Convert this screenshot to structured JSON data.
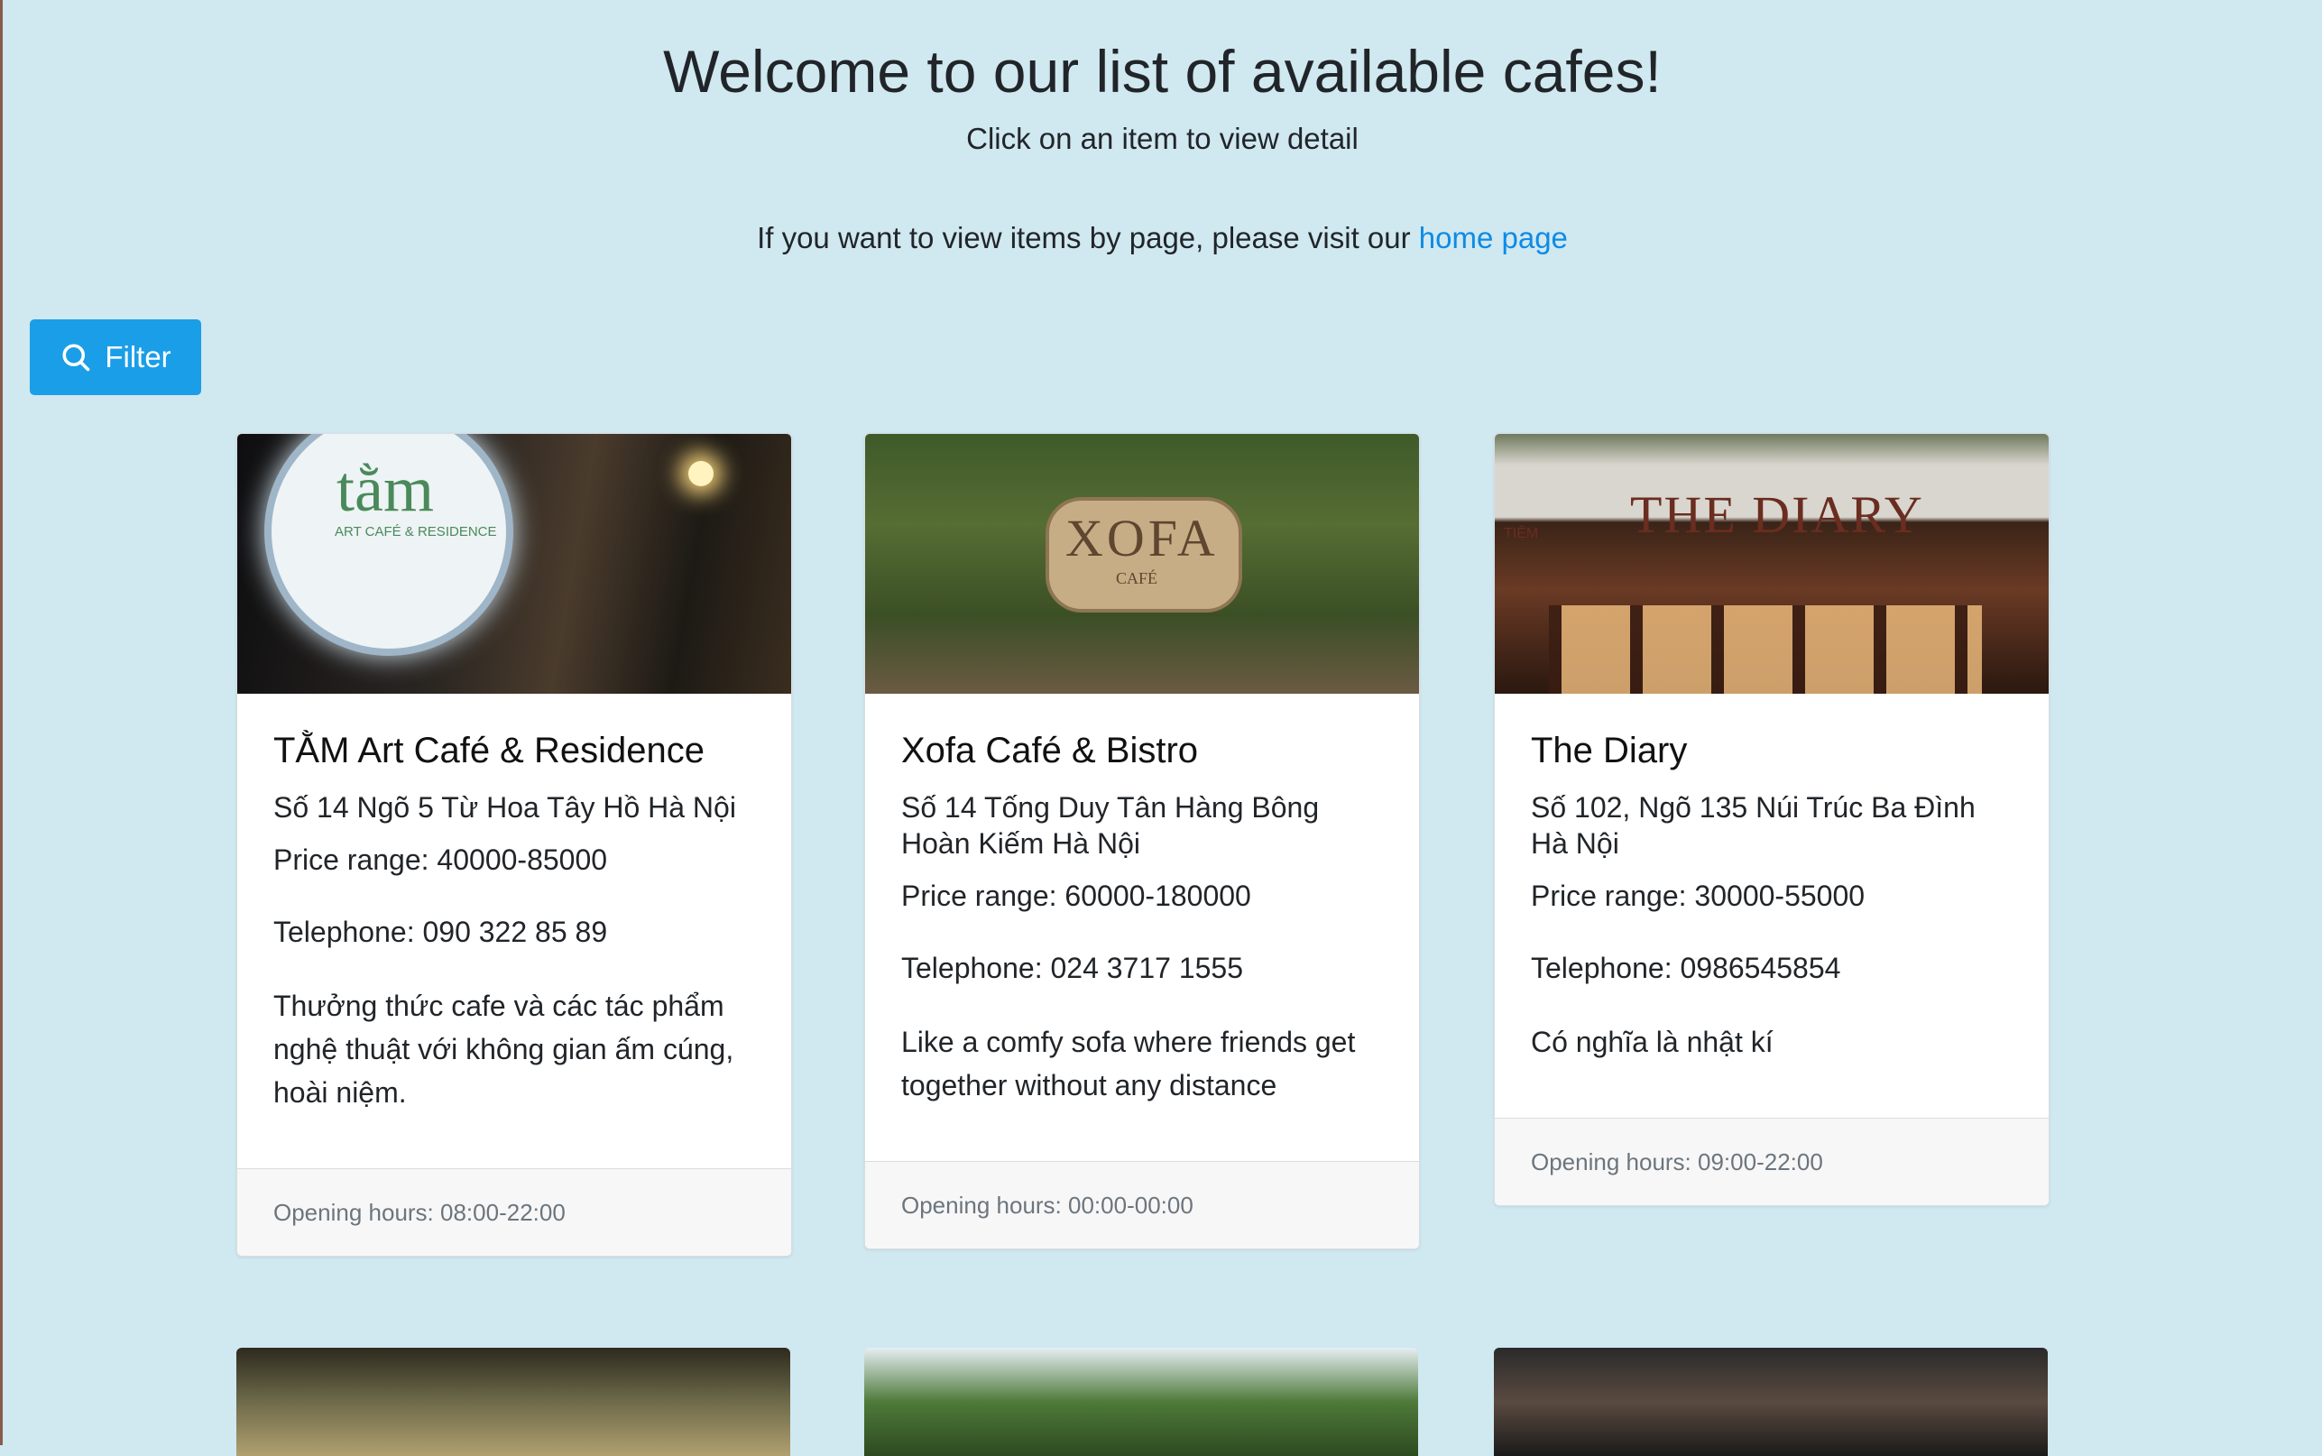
{
  "header": {
    "title": "Welcome to our list of available cafes!",
    "subtitle": "Click on an item to view detail",
    "visit_prefix": "If you want to view items by page, please visit our ",
    "home_link": "home page"
  },
  "filter": {
    "label": "Filter",
    "icon": "search-icon",
    "color": "#1a9ee8"
  },
  "colors": {
    "background": "#d0e8f0",
    "link": "#0d8be6"
  },
  "cafes": [
    {
      "name": "TẰM Art Café & Residence",
      "address": "Số 14 Ngõ 5 Từ Hoa Tây Hồ Hà Nội",
      "price": "Price range: 40000-85000",
      "telephone": "Telephone: 090 322 85 89",
      "description": "Thưởng thức cafe và các tác phẩm nghệ thuật với không gian ấm cúng, hoài niệm.",
      "hours": "Opening hours: 08:00-22:00",
      "image_text": "tằm",
      "image_subtext": "ART CAFÉ & RESIDENCE"
    },
    {
      "name": "Xofa Café & Bistro",
      "address": "Số 14 Tống Duy Tân Hàng Bông Hoàn Kiếm Hà Nội",
      "price": "Price range: 60000-180000",
      "telephone": "Telephone: 024 3717 1555",
      "description": "Like a comfy sofa where friends get together without any distance",
      "hours": "Opening hours: 00:00-00:00",
      "image_text": "XOFA",
      "image_subtext": "CAFÉ"
    },
    {
      "name": "The Diary",
      "address": "Số 102, Ngõ 135 Núi Trúc Ba Đình Hà Nội",
      "price": "Price range: 30000-55000",
      "telephone": "Telephone: 0986545854",
      "description": "Có nghĩa là nhật kí",
      "hours": "Opening hours: 09:00-22:00",
      "image_text": "THE DIARY",
      "image_subtext": "TIỆM"
    }
  ]
}
